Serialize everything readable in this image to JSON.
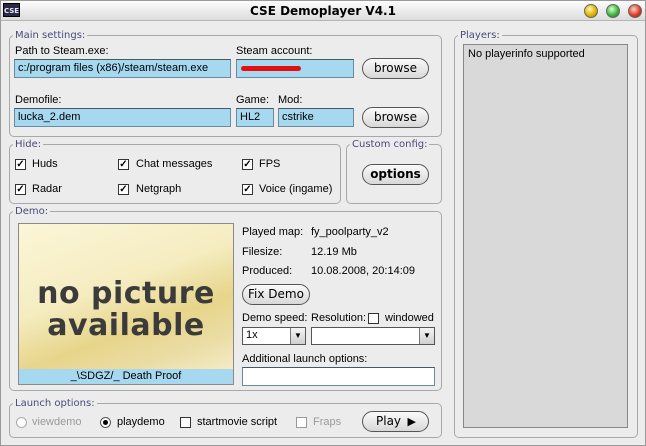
{
  "window": {
    "title": "CSE Demoplayer V4.1",
    "icon_text": "CSE"
  },
  "main_settings": {
    "legend": "Main settings:",
    "path_label": "Path to Steam.exe:",
    "path_value": "c:/program files (x86)/steam/steam.exe",
    "account_label": "Steam account:",
    "account_value": "",
    "browse_label": "browse",
    "demofile_label": "Demofile:",
    "demofile_value": "lucka_2.dem",
    "game_label": "Game:",
    "game_value": "HL2",
    "mod_label": "Mod:",
    "mod_value": "cstrike",
    "browse2_label": "browse"
  },
  "hide": {
    "legend": "Hide:",
    "items": [
      {
        "label": "Huds",
        "checked": true
      },
      {
        "label": "Chat messages",
        "checked": true
      },
      {
        "label": "FPS",
        "checked": true
      },
      {
        "label": "Radar",
        "checked": true
      },
      {
        "label": "Netgraph",
        "checked": true
      },
      {
        "label": "Voice (ingame)",
        "checked": true
      }
    ]
  },
  "custom_config": {
    "legend": "Custom config:",
    "options_label": "options"
  },
  "demo": {
    "legend": "Demo:",
    "preview_line1": "no picture",
    "preview_line2": "available",
    "preview_caption": "_\\SDGZ/_ Death Proof",
    "played_map_label": "Played map:",
    "played_map_value": "fy_poolparty_v2",
    "filesize_label": "Filesize:",
    "filesize_value": "12.19 Mb",
    "produced_label": "Produced:",
    "produced_value": "10.08.2008, 20:14:09",
    "fix_demo_label": "Fix Demo",
    "demo_speed_label": "Demo speed:",
    "demo_speed_value": "1x",
    "resolution_label": "Resolution:",
    "resolution_value": "",
    "windowed_label": "windowed",
    "additional_label": "Additional launch options:",
    "additional_value": ""
  },
  "launch": {
    "legend": "Launch options:",
    "viewdemo_label": "viewdemo",
    "playdemo_label": "playdemo",
    "startmovie_label": "startmovie script",
    "fraps_label": "Fraps",
    "play_label": "Play"
  },
  "players": {
    "legend": "Players:",
    "info": "No playerinfo supported"
  }
}
